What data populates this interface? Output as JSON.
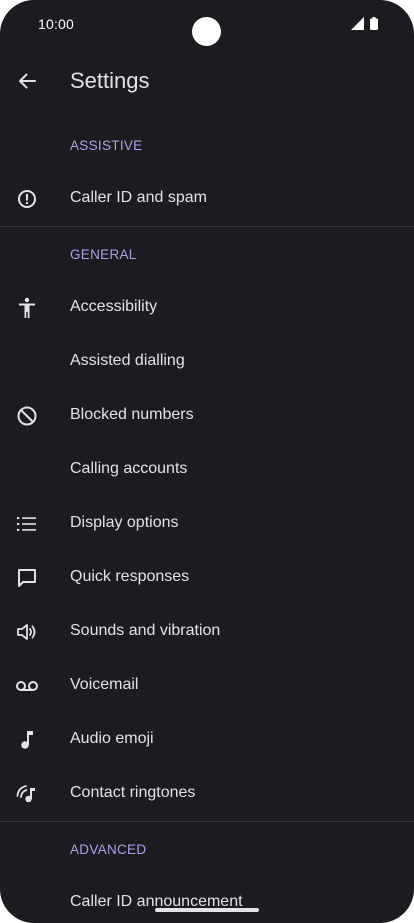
{
  "status_bar": {
    "time": "10:00"
  },
  "app_bar": {
    "title": "Settings"
  },
  "sections": {
    "assistive": {
      "header": "ASSISTIVE",
      "items": [
        {
          "label": "Caller ID and spam",
          "icon": "alert-circle-icon"
        }
      ]
    },
    "general": {
      "header": "GENERAL",
      "items": [
        {
          "label": "Accessibility",
          "icon": "accessibility-icon"
        },
        {
          "label": "Assisted dialling",
          "icon": ""
        },
        {
          "label": "Blocked numbers",
          "icon": "block-icon"
        },
        {
          "label": "Calling accounts",
          "icon": ""
        },
        {
          "label": "Display options",
          "icon": "list-icon"
        },
        {
          "label": "Quick responses",
          "icon": "chat-bubble-icon"
        },
        {
          "label": "Sounds and vibration",
          "icon": "volume-icon"
        },
        {
          "label": "Voicemail",
          "icon": "voicemail-icon"
        },
        {
          "label": "Audio emoji",
          "icon": "music-note-icon"
        },
        {
          "label": "Contact ringtones",
          "icon": "ringtone-icon"
        }
      ]
    },
    "advanced": {
      "header": "ADVANCED",
      "items": [
        {
          "label": "Caller ID announcement",
          "icon": ""
        }
      ]
    }
  },
  "colors": {
    "background": "#1c1b20",
    "text": "#e6e1e5",
    "section_header": "#aaa2ec",
    "divider": "#38363d"
  }
}
